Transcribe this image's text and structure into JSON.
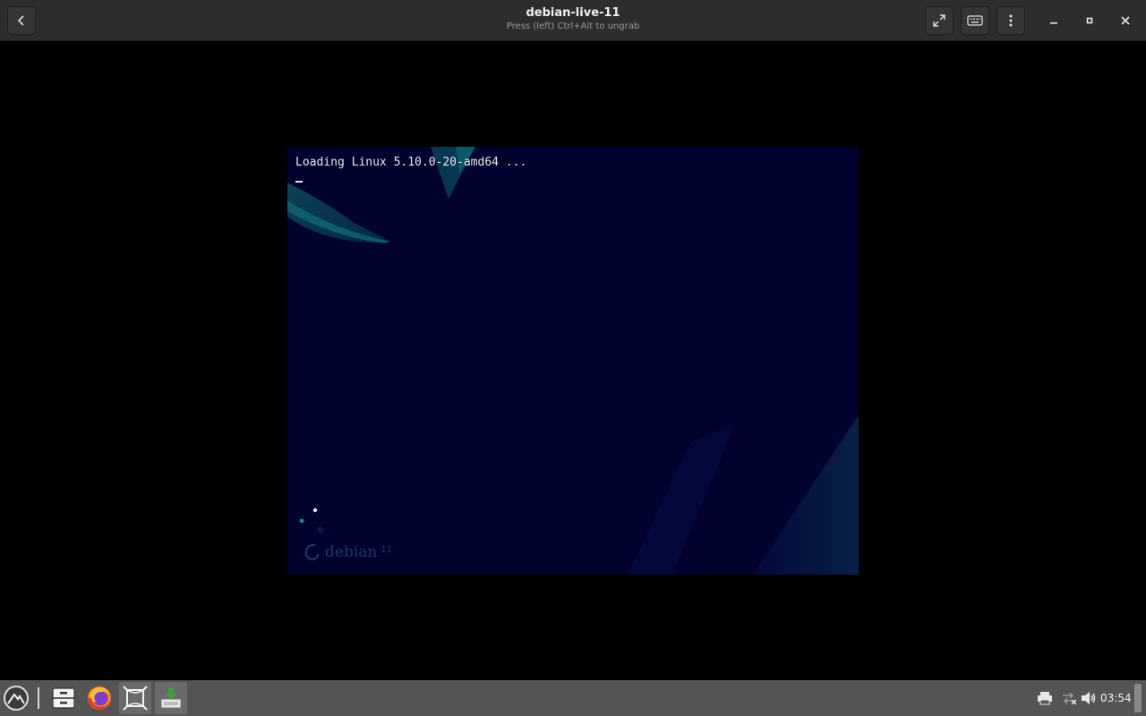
{
  "window": {
    "title": "debian-live-11",
    "subtitle": "Press (left) Ctrl+Alt to ungrab"
  },
  "header": {
    "left_buttons": [
      {
        "name": "back",
        "icon": "chevron-left-icon"
      }
    ],
    "right_buttons": [
      {
        "name": "fullscreen",
        "icon": "expand-arrows-icon"
      },
      {
        "name": "send-keys",
        "icon": "keyboard-icon"
      },
      {
        "name": "menu",
        "icon": "vertical-dots-icon"
      }
    ],
    "window_controls": [
      "minimize-icon",
      "maximize-icon",
      "close-icon"
    ]
  },
  "vm": {
    "boot_message": "Loading Linux 5.10.0-20-amd64 ...",
    "cursor": "_",
    "brand_word": "debian",
    "brand_version": "11",
    "background_color": "#02022e"
  },
  "taskbar": {
    "apps": [
      {
        "name": "app-menu",
        "icon": "mountain-logo-icon"
      },
      {
        "name": "file-manager",
        "icon": "file-cabinet-icon"
      },
      {
        "name": "firefox",
        "icon": "firefox-icon"
      },
      {
        "name": "virtual-machine-manager",
        "icon": "vm-frame-icon",
        "active": true
      },
      {
        "name": "install",
        "icon": "download-tray-icon",
        "active": true
      }
    ],
    "tray": [
      "printer-icon",
      "network-disconnected-icon",
      "volume-icon"
    ],
    "clock": "03:54"
  },
  "colors": {
    "headerbar": "#2d2d2d",
    "taskbar": "#545454",
    "vm_screen": "#02022e",
    "accent_teal": "#0f6e7a",
    "install_green": "#3aa03a"
  }
}
